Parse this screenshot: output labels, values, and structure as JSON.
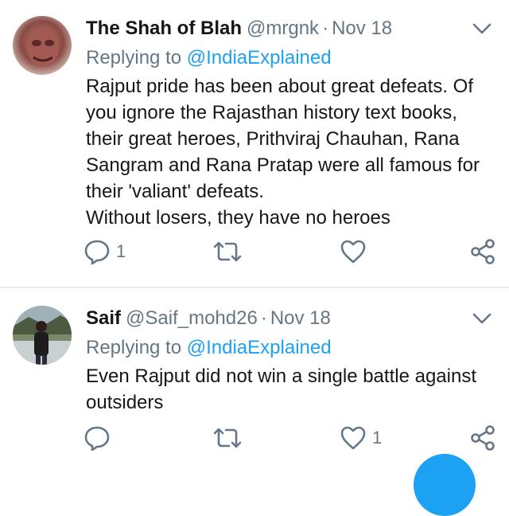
{
  "tweets": [
    {
      "name": "The Shah of Blah",
      "handle": "@mrgnk",
      "separator": "·",
      "date": "Nov 18",
      "replying_prefix": "Replying to",
      "replying_to": "@IndiaExplained",
      "lines": [
        "Rajput pride has been about great defeats. Of",
        "you ignore the Rajasthan history text books,",
        "their great heroes, Prithviraj Chauhan, Rana",
        "Sangram and Rana Pratap were all famous for",
        "their 'valiant' defeats.",
        "Without losers, they have no heroes"
      ],
      "reply_count": "1",
      "retweet_count": "",
      "like_count": ""
    },
    {
      "name": "Saif",
      "handle": "@Saif_mohd26",
      "separator": "·",
      "date": "Nov 18",
      "replying_prefix": "Replying to",
      "replying_to": "@IndiaExplained",
      "lines": [
        "Even Rajput did not win a single battle against",
        "outsiders"
      ],
      "reply_count": "",
      "retweet_count": "",
      "like_count": "1"
    }
  ],
  "icons": {
    "reply": "reply-icon",
    "retweet": "retweet-icon",
    "like": "heart-icon",
    "share": "share-icon",
    "menu": "chevron-down-icon"
  },
  "colors": {
    "accent": "#1da1f2",
    "muted": "#657786",
    "text": "#14171a",
    "divider": "#e6ecf0"
  }
}
